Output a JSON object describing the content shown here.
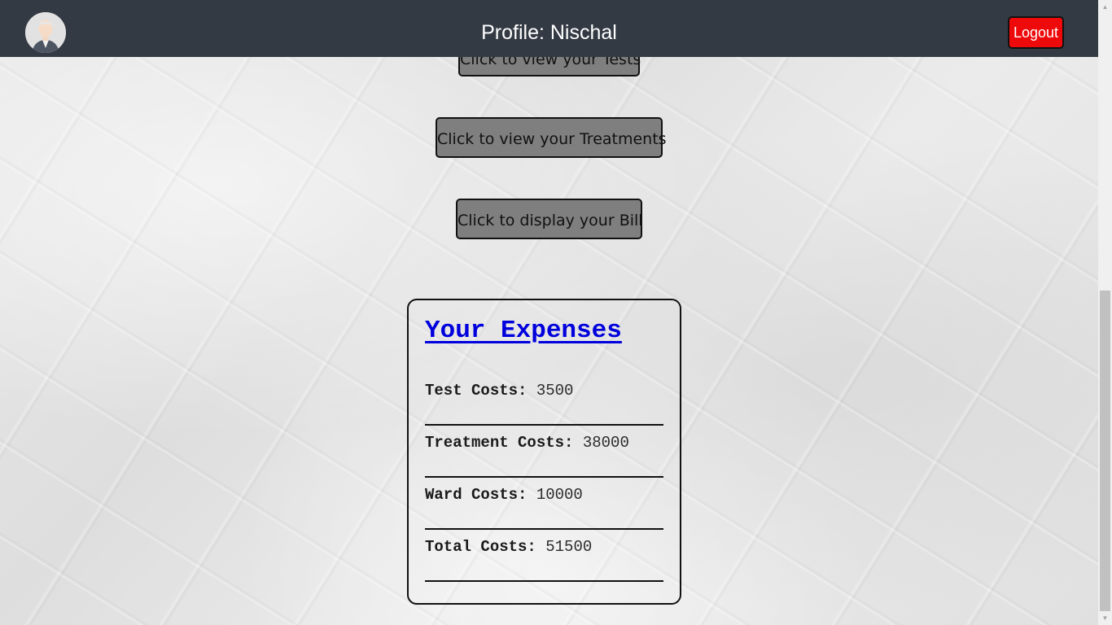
{
  "header": {
    "title": "Profile: Nischal",
    "logout_label": "Logout",
    "avatar_icon": "user-avatar-icon",
    "background": "#343a44"
  },
  "actions": {
    "tests_label": "Click to view your Tests",
    "treatments_label": "Click to view your Treatments",
    "bill_label": "Click to display your Bill"
  },
  "expenses": {
    "title": "Your Expenses",
    "rows": [
      {
        "label": "Test Costs:",
        "value": "3500"
      },
      {
        "label": "Treatment Costs:",
        "value": "38000"
      },
      {
        "label": "Ward Costs:",
        "value": "10000"
      },
      {
        "label": "Total Costs:",
        "value": "51500"
      }
    ]
  },
  "colors": {
    "logout": "#ee0a0a",
    "button_bg": "#7f7f7f",
    "title_link": "#0000dd"
  }
}
